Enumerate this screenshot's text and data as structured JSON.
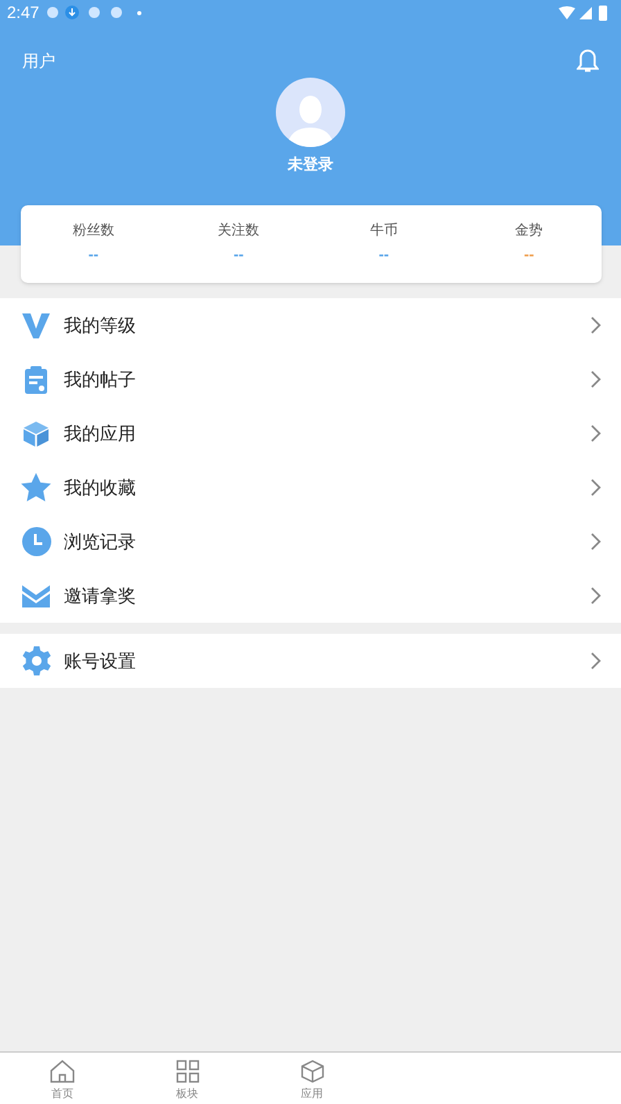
{
  "status_bar": {
    "time": "2:47"
  },
  "header": {
    "title": "用户",
    "user_name": "未登录"
  },
  "stats": [
    {
      "label": "粉丝数",
      "value": "--",
      "color": "#5aa6ea"
    },
    {
      "label": "关注数",
      "value": "--",
      "color": "#5aa6ea"
    },
    {
      "label": "牛币",
      "value": "--",
      "color": "#5aa6ea"
    },
    {
      "label": "金势",
      "value": "--",
      "color": "#f0a050"
    }
  ],
  "menu": [
    {
      "kind": "level",
      "label": "我的等级"
    },
    {
      "kind": "posts",
      "label": "我的帖子"
    },
    {
      "kind": "apps",
      "label": "我的应用"
    },
    {
      "kind": "favorites",
      "label": "我的收藏"
    },
    {
      "kind": "history",
      "label": "浏览记录"
    },
    {
      "kind": "invite",
      "label": "邀请拿奖"
    }
  ],
  "settings_menu": [
    {
      "kind": "settings",
      "label": "账号设置"
    }
  ],
  "bottom_nav": [
    {
      "kind": "home",
      "label": "首页",
      "selected": false
    },
    {
      "kind": "boards",
      "label": "板块",
      "selected": false
    },
    {
      "kind": "apps",
      "label": "应用",
      "selected": false
    }
  ]
}
